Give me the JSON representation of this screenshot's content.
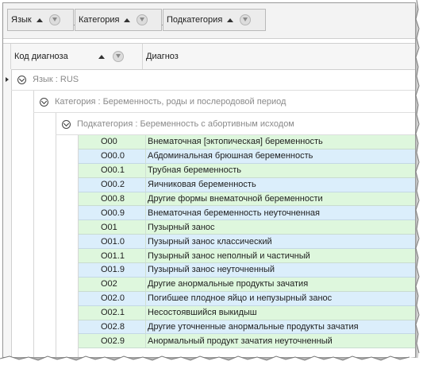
{
  "group_panel": {
    "chips": [
      {
        "label": "Язык"
      },
      {
        "label": "Категория"
      },
      {
        "label": "Подкатегория"
      }
    ]
  },
  "columns": {
    "code": "Код диагноза",
    "diagnosis": "Диагноз"
  },
  "groups": {
    "language": "Язык : RUS",
    "category": "Категория : Беременность, роды и послеродовой период",
    "subcategory": "Подкатегория : Беременность с абортивным исходом"
  },
  "rows": [
    {
      "code": "O00",
      "name": "Внематочная [эктопическая] беременность"
    },
    {
      "code": "O00.0",
      "name": "Абдоминальная  брюшная   беременность"
    },
    {
      "code": "O00.1",
      "name": "Трубная беременность"
    },
    {
      "code": "O00.2",
      "name": "Яичниковая беременность"
    },
    {
      "code": "O00.8",
      "name": "Другие формы внематочной беременности"
    },
    {
      "code": "O00.9",
      "name": "Внематочная беременность неуточненная"
    },
    {
      "code": "O01",
      "name": "Пузырный занос"
    },
    {
      "code": "O01.0",
      "name": "Пузырный занос классический"
    },
    {
      "code": "O01.1",
      "name": "Пузырный занос неполный и частичный"
    },
    {
      "code": "O01.9",
      "name": "Пузырный занос неуточненный"
    },
    {
      "code": "O02",
      "name": "Другие анормальные продукты зачатия"
    },
    {
      "code": "O02.0",
      "name": "Погибшее плодное яйцо и непузырный занос"
    },
    {
      "code": "O02.1",
      "name": "Несостоявшийся выкидыш"
    },
    {
      "code": "O02.8",
      "name": "Другие уточненные анормальные продукты зачатия"
    },
    {
      "code": "O02.9",
      "name": "Анормальный продукт зачатия неуточненный"
    }
  ],
  "colors": {
    "row_green": "#def7dd",
    "row_blue": "#dbeefb"
  }
}
